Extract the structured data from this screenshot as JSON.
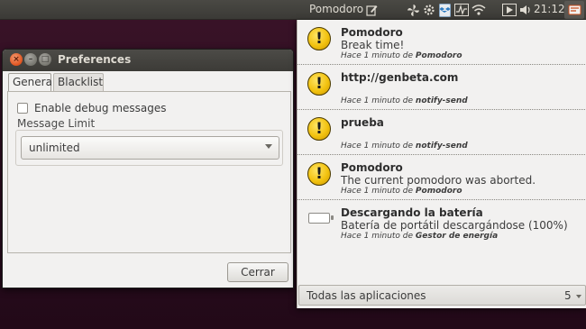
{
  "panel": {
    "app_title": "Pomodoro",
    "clock": "21:12",
    "indicators": [
      "note-icon",
      "pinwheel-icon",
      "gear-icon",
      "dropbox-icon",
      "system-monitor-icon",
      "wifi-icon",
      "media-icon",
      "volume-icon",
      "notifications-icon"
    ]
  },
  "preferences": {
    "title": "Preferences",
    "tabs": [
      "General",
      "Blacklist"
    ],
    "debug_label": "Enable debug messages",
    "debug_checked": false,
    "message_limit_label": "Message Limit",
    "message_limit_value": "unlimited",
    "close_button": "Cerrar"
  },
  "notifications": {
    "items": [
      {
        "icon": "warning-icon",
        "title": "Pomodoro",
        "body": "Break time!",
        "meta_prefix": "Hace 1 minuto de",
        "source": "Pomodoro"
      },
      {
        "icon": "warning-icon",
        "title": "http://genbeta.com",
        "body": "",
        "meta_prefix": "Hace 1 minuto de",
        "source": "notify-send"
      },
      {
        "icon": "warning-icon",
        "title": "prueba",
        "body": "",
        "meta_prefix": "Hace 1 minuto de",
        "source": "notify-send"
      },
      {
        "icon": "warning-icon",
        "title": "Pomodoro",
        "body": "The current pomodoro was aborted.",
        "meta_prefix": "Hace 1 minuto de",
        "source": "Pomodoro"
      },
      {
        "icon": "battery-icon",
        "title": "Descargando la batería",
        "body": "Batería de portátil descargándose (100%)",
        "meta_prefix": "Hace 1 minuto de",
        "source": "Gestor de energía"
      }
    ],
    "filter_label": "Todas las aplicaciones",
    "count": "5"
  }
}
